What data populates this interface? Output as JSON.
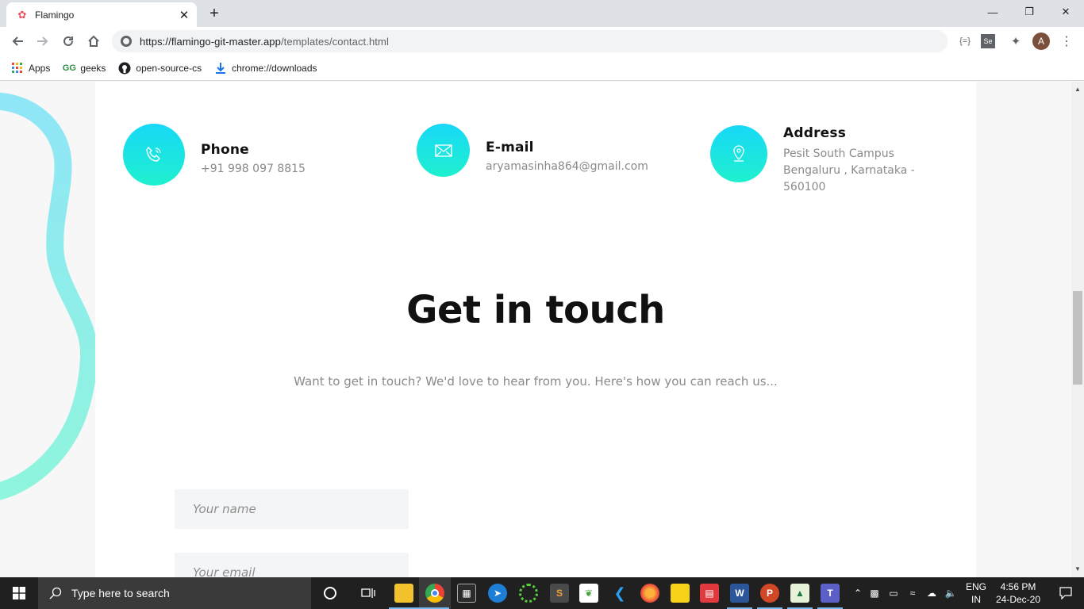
{
  "browser": {
    "tab_title": "Flamingo",
    "url_host": "https://flamingo-git-master.app",
    "url_path": "/templates/contact.html",
    "avatar_letter": "A",
    "bookmarks": [
      {
        "label": "Apps",
        "icon": "apps-grid-icon"
      },
      {
        "label": "geeks",
        "icon": "geeksforgeeks-icon"
      },
      {
        "label": "open-source-cs",
        "icon": "github-icon"
      },
      {
        "label": "chrome://downloads",
        "icon": "download-icon"
      }
    ]
  },
  "page": {
    "contacts": [
      {
        "title": "Phone",
        "value": "+91 998 097 8815",
        "icon": "phone-icon"
      },
      {
        "title": "E-mail",
        "value": "aryamasinha864@gmail.com",
        "icon": "envelope-icon"
      },
      {
        "title": "Address",
        "value_lines": [
          "Pesit South Campus",
          "Bengaluru , Karnataka -",
          "560100"
        ],
        "icon": "location-pin-icon"
      }
    ],
    "heading": "Get in touch",
    "subheading": "Want to get in touch? We'd love to hear from you. Here's how you can reach us...",
    "form": {
      "name_placeholder": "Your name",
      "email_placeholder": "Your email"
    },
    "colors": {
      "icon_gradient_top": "#17d8f6",
      "icon_gradient_bottom": "#1ff0cf"
    }
  },
  "taskbar": {
    "search_placeholder": "Type here to search",
    "language": "ENG",
    "region": "IN",
    "time": "4:56 PM",
    "date": "24-Dec-20"
  }
}
